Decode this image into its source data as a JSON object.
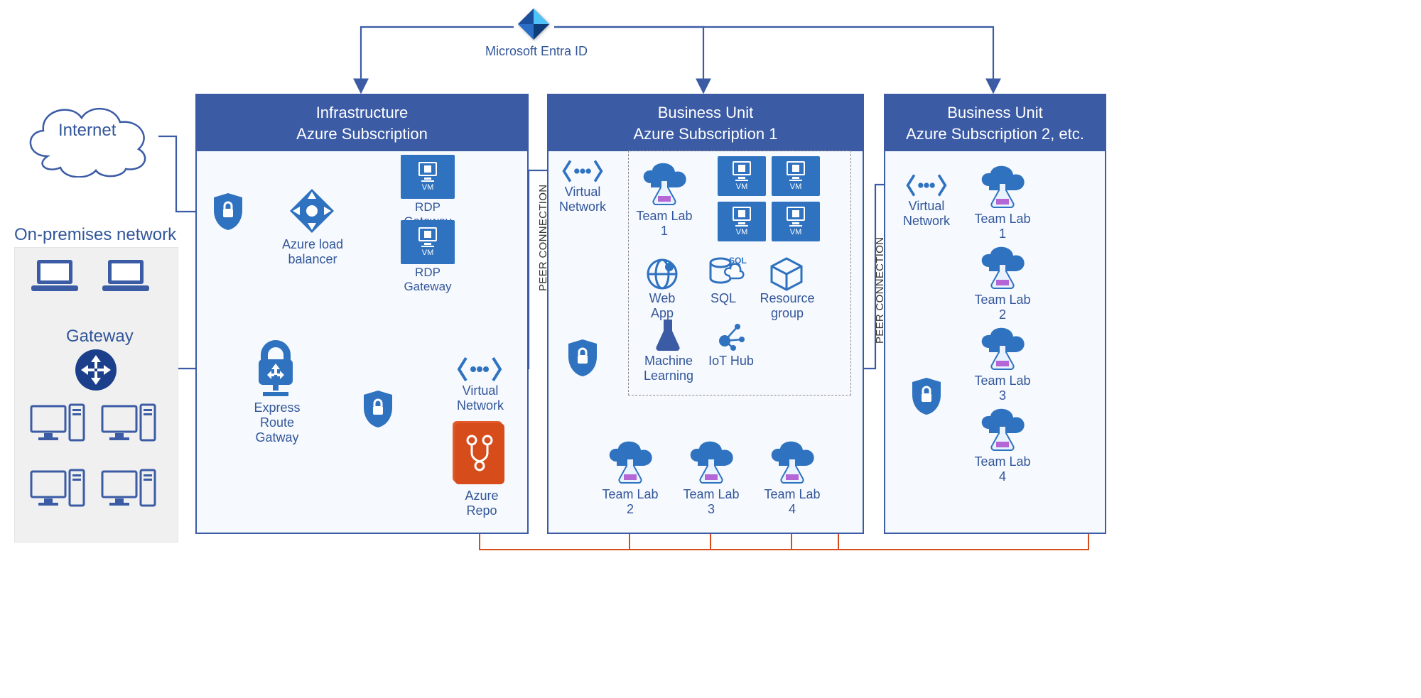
{
  "top": {
    "entra_label": "Microsoft Entra ID"
  },
  "internet": {
    "label": "Internet"
  },
  "onprem": {
    "title": "On-premises network",
    "gateway": "Gateway"
  },
  "infra": {
    "title_line1": "Infrastructure",
    "title_line2": "Azure Subscription",
    "alb": "Azure load\nbalancer",
    "rdp1": "RDP Gateway",
    "rdp2": "RDP Gateway",
    "erg": "Express Route\nGatway",
    "vnet": "Virtual\nNetwork",
    "repo": "Azure\nRepo",
    "vm_txt": "VM"
  },
  "bu1": {
    "title_line1": "Business Unit",
    "title_line2": "Azure Subscription 1",
    "vnet": "Virtual\nNetwork",
    "peer": "PEER CONNECTION",
    "teamlab1": "Team Lab 1",
    "teamlab2": "Team Lab 2",
    "teamlab3": "Team Lab 3",
    "teamlab4": "Team Lab 4",
    "webapp": "Web App",
    "sql": "SQL",
    "rg": "Resource\ngroup",
    "ml": "Machine\nLearning",
    "iot": "IoT Hub",
    "vm_txt": "VM"
  },
  "bu2": {
    "title_line1": "Business Unit",
    "title_line2": "Azure Subscription 2, etc.",
    "vnet": "Virtual\nNetwork",
    "peer": "PEER CONNECTION",
    "teamlab1": "Team Lab 1",
    "teamlab2": "Team Lab 2",
    "teamlab3": "Team Lab 3",
    "teamlab4": "Team Lab 4"
  }
}
